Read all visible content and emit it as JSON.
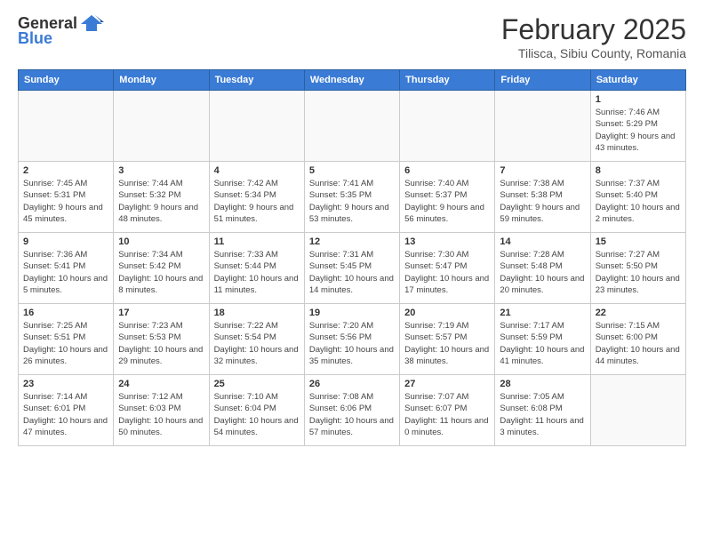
{
  "header": {
    "logo_general": "General",
    "logo_blue": "Blue",
    "month_year": "February 2025",
    "location": "Tilisca, Sibiu County, Romania"
  },
  "weekdays": [
    "Sunday",
    "Monday",
    "Tuesday",
    "Wednesday",
    "Thursday",
    "Friday",
    "Saturday"
  ],
  "weeks": [
    [
      {
        "day": "",
        "info": ""
      },
      {
        "day": "",
        "info": ""
      },
      {
        "day": "",
        "info": ""
      },
      {
        "day": "",
        "info": ""
      },
      {
        "day": "",
        "info": ""
      },
      {
        "day": "",
        "info": ""
      },
      {
        "day": "1",
        "info": "Sunrise: 7:46 AM\nSunset: 5:29 PM\nDaylight: 9 hours and 43 minutes."
      }
    ],
    [
      {
        "day": "2",
        "info": "Sunrise: 7:45 AM\nSunset: 5:31 PM\nDaylight: 9 hours and 45 minutes."
      },
      {
        "day": "3",
        "info": "Sunrise: 7:44 AM\nSunset: 5:32 PM\nDaylight: 9 hours and 48 minutes."
      },
      {
        "day": "4",
        "info": "Sunrise: 7:42 AM\nSunset: 5:34 PM\nDaylight: 9 hours and 51 minutes."
      },
      {
        "day": "5",
        "info": "Sunrise: 7:41 AM\nSunset: 5:35 PM\nDaylight: 9 hours and 53 minutes."
      },
      {
        "day": "6",
        "info": "Sunrise: 7:40 AM\nSunset: 5:37 PM\nDaylight: 9 hours and 56 minutes."
      },
      {
        "day": "7",
        "info": "Sunrise: 7:38 AM\nSunset: 5:38 PM\nDaylight: 9 hours and 59 minutes."
      },
      {
        "day": "8",
        "info": "Sunrise: 7:37 AM\nSunset: 5:40 PM\nDaylight: 10 hours and 2 minutes."
      }
    ],
    [
      {
        "day": "9",
        "info": "Sunrise: 7:36 AM\nSunset: 5:41 PM\nDaylight: 10 hours and 5 minutes."
      },
      {
        "day": "10",
        "info": "Sunrise: 7:34 AM\nSunset: 5:42 PM\nDaylight: 10 hours and 8 minutes."
      },
      {
        "day": "11",
        "info": "Sunrise: 7:33 AM\nSunset: 5:44 PM\nDaylight: 10 hours and 11 minutes."
      },
      {
        "day": "12",
        "info": "Sunrise: 7:31 AM\nSunset: 5:45 PM\nDaylight: 10 hours and 14 minutes."
      },
      {
        "day": "13",
        "info": "Sunrise: 7:30 AM\nSunset: 5:47 PM\nDaylight: 10 hours and 17 minutes."
      },
      {
        "day": "14",
        "info": "Sunrise: 7:28 AM\nSunset: 5:48 PM\nDaylight: 10 hours and 20 minutes."
      },
      {
        "day": "15",
        "info": "Sunrise: 7:27 AM\nSunset: 5:50 PM\nDaylight: 10 hours and 23 minutes."
      }
    ],
    [
      {
        "day": "16",
        "info": "Sunrise: 7:25 AM\nSunset: 5:51 PM\nDaylight: 10 hours and 26 minutes."
      },
      {
        "day": "17",
        "info": "Sunrise: 7:23 AM\nSunset: 5:53 PM\nDaylight: 10 hours and 29 minutes."
      },
      {
        "day": "18",
        "info": "Sunrise: 7:22 AM\nSunset: 5:54 PM\nDaylight: 10 hours and 32 minutes."
      },
      {
        "day": "19",
        "info": "Sunrise: 7:20 AM\nSunset: 5:56 PM\nDaylight: 10 hours and 35 minutes."
      },
      {
        "day": "20",
        "info": "Sunrise: 7:19 AM\nSunset: 5:57 PM\nDaylight: 10 hours and 38 minutes."
      },
      {
        "day": "21",
        "info": "Sunrise: 7:17 AM\nSunset: 5:59 PM\nDaylight: 10 hours and 41 minutes."
      },
      {
        "day": "22",
        "info": "Sunrise: 7:15 AM\nSunset: 6:00 PM\nDaylight: 10 hours and 44 minutes."
      }
    ],
    [
      {
        "day": "23",
        "info": "Sunrise: 7:14 AM\nSunset: 6:01 PM\nDaylight: 10 hours and 47 minutes."
      },
      {
        "day": "24",
        "info": "Sunrise: 7:12 AM\nSunset: 6:03 PM\nDaylight: 10 hours and 50 minutes."
      },
      {
        "day": "25",
        "info": "Sunrise: 7:10 AM\nSunset: 6:04 PM\nDaylight: 10 hours and 54 minutes."
      },
      {
        "day": "26",
        "info": "Sunrise: 7:08 AM\nSunset: 6:06 PM\nDaylight: 10 hours and 57 minutes."
      },
      {
        "day": "27",
        "info": "Sunrise: 7:07 AM\nSunset: 6:07 PM\nDaylight: 11 hours and 0 minutes."
      },
      {
        "day": "28",
        "info": "Sunrise: 7:05 AM\nSunset: 6:08 PM\nDaylight: 11 hours and 3 minutes."
      },
      {
        "day": "",
        "info": ""
      }
    ]
  ]
}
